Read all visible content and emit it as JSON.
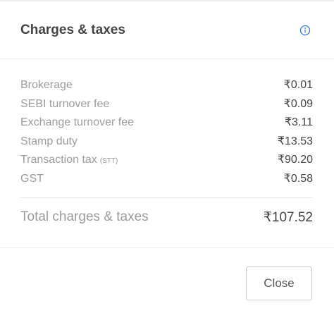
{
  "dialog": {
    "title": "Charges & taxes",
    "info_icon": "info-icon",
    "accent_color": "#387ed1"
  },
  "charges": [
    {
      "label": "Brokerage",
      "sub": "",
      "value": "₹0.01"
    },
    {
      "label": "SEBI turnover fee",
      "sub": "",
      "value": "₹0.09"
    },
    {
      "label": "Exchange turnover fee",
      "sub": "",
      "value": "₹3.11"
    },
    {
      "label": "Stamp duty",
      "sub": "",
      "value": "₹13.53"
    },
    {
      "label": "Transaction tax",
      "sub": "(STT)",
      "value": "₹90.20"
    },
    {
      "label": "GST",
      "sub": "",
      "value": "₹0.58"
    }
  ],
  "total": {
    "label": "Total charges & taxes",
    "value": "₹107.52"
  },
  "footer": {
    "close_label": "Close"
  }
}
